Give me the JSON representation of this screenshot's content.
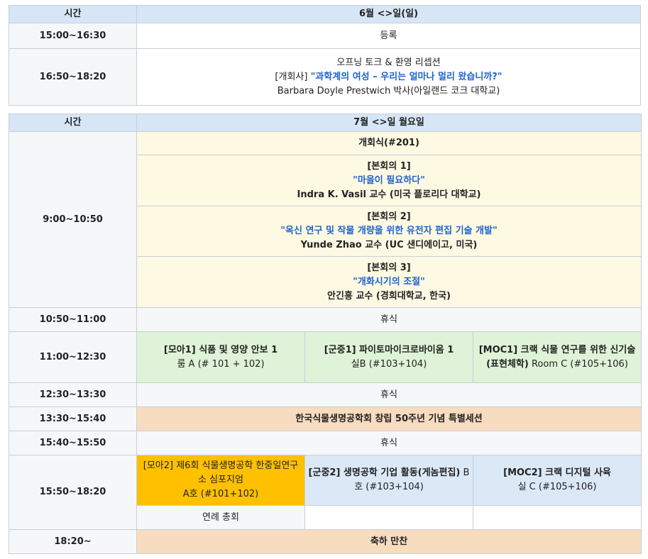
{
  "day1": {
    "col_time": "시간",
    "col_day": "6월 <>일(일)",
    "rows": [
      {
        "time": "15:00~16:30",
        "text": "등록"
      },
      {
        "time": "16:50~18:20",
        "line1": "오프닝 토크 & 환영 리셉션",
        "prefix": "[개회사] ",
        "title": "\"과학계의 여성 – 우리는 얼마나 멀리 왔습니까?\"",
        "speaker": "Barbara Doyle Prestwich 박사(아일랜드 코크 대학교)"
      }
    ]
  },
  "day2": {
    "col_time": "시간",
    "col_day": "7월 <>일 월요일",
    "opening": {
      "time": "9:00~10:50",
      "ceremony": "개회식(#201)",
      "plenaries": [
        {
          "label": "[본회의 1]",
          "title": "\"마을이 필요하다\"",
          "speaker": "Indra K. Vasil 교수 (미국 플로리다 대학교)"
        },
        {
          "label": "[본회의 2]",
          "title": "\"옥신 연구 및 작물 개량을 위한 유전자 편집 기술 개발\"",
          "speaker": "Yunde Zhao 교수 (UC 샌디에이고, 미국)"
        },
        {
          "label": "[본회의 3]",
          "title": "\"개화시기의 조절\"",
          "speaker": "안긴흥 교수 (경희대학교, 한국)"
        }
      ]
    },
    "break1": {
      "time": "10:50~11:00",
      "text": "휴식"
    },
    "session1": {
      "time": "11:00~12:30",
      "a": {
        "title": "[모아1] 식품 및 영양 안보 1",
        "room": "룸 A (# 101 + 102)"
      },
      "b": {
        "title": "[군중1] 파이토마이크로바이옴 1",
        "room": "실B (#103+104)"
      },
      "c": {
        "title": "[MOC1] 크랙 식물 연구를 위한 신기술(표현체학)",
        "room": " Room C (#105+106)"
      }
    },
    "break2": {
      "time": "12:30~13:30",
      "text": "휴식"
    },
    "special": {
      "time": "13:30~15:40",
      "text": "한국식물생명공학회 창립 50주년 기념 특별세션"
    },
    "break3": {
      "time": "15:40~15:50",
      "text": "휴식"
    },
    "session2": {
      "time": "15:50~18:20",
      "a": {
        "title": "[모아2] 제6회 식물생명공학 한중일연구소 심포지엄",
        "room": "A호 (#101+102)"
      },
      "b": {
        "title": "[군중2] 생명공학 기업 활동(게놈편집)",
        "room": " B호 (#103+104)"
      },
      "c": {
        "title": "[MOC2] 크랙 디지털 사육",
        "room": "실 C (#105+106)"
      },
      "assembly": "연례 총회"
    },
    "banquet": {
      "time": "18:20~",
      "text": "축하 만찬"
    }
  }
}
